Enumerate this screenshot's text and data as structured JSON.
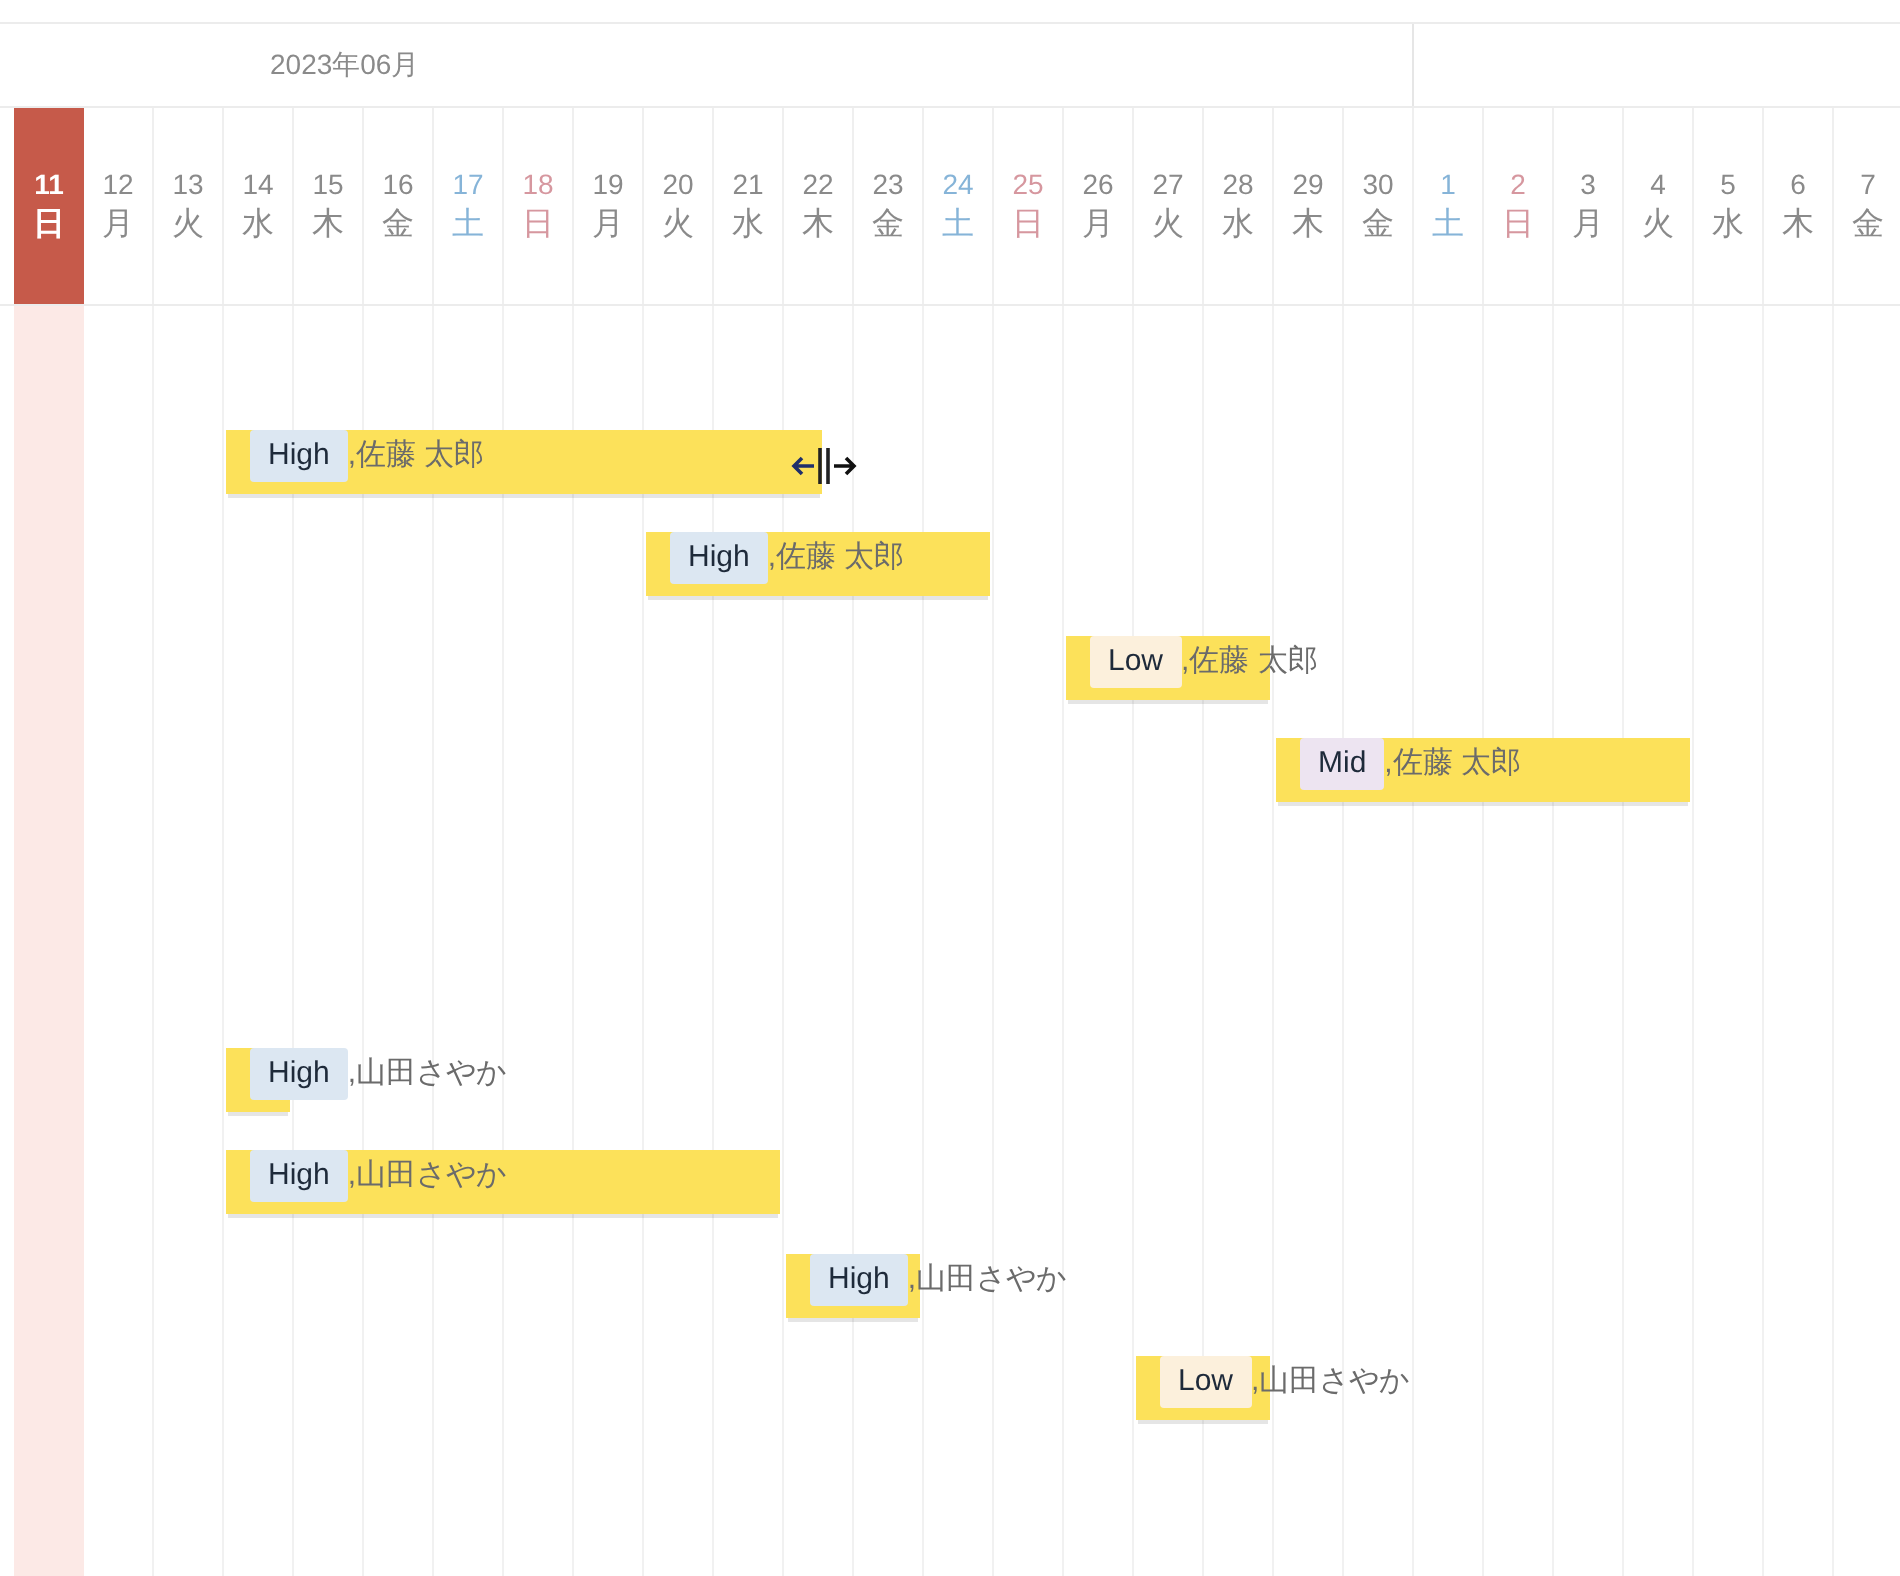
{
  "gantt": {
    "months": [
      {
        "label": "2023年06月",
        "days": [
          {
            "number": "11",
            "weekday": "日",
            "today": true
          },
          {
            "number": "12",
            "weekday": "月",
            "kind": "weekday",
            "today": false
          },
          {
            "number": "13",
            "weekday": "火",
            "kind": "weekday",
            "today": false
          },
          {
            "number": "14",
            "weekday": "水",
            "kind": "weekday",
            "today": false
          },
          {
            "number": "15",
            "weekday": "木",
            "kind": "weekday",
            "today": false
          },
          {
            "number": "16",
            "weekday": "金",
            "kind": "weekday",
            "today": false
          },
          {
            "number": "17",
            "weekday": "土",
            "kind": "saturday",
            "today": false
          },
          {
            "number": "18",
            "weekday": "日",
            "kind": "sunday",
            "today": false
          },
          {
            "number": "19",
            "weekday": "月",
            "kind": "weekday",
            "today": false
          },
          {
            "number": "20",
            "weekday": "火",
            "kind": "weekday",
            "today": false
          },
          {
            "number": "21",
            "weekday": "水",
            "kind": "weekday",
            "today": false
          },
          {
            "number": "22",
            "weekday": "木",
            "kind": "weekday",
            "today": false
          },
          {
            "number": "23",
            "weekday": "金",
            "kind": "weekday",
            "today": false
          },
          {
            "number": "24",
            "weekday": "土",
            "kind": "saturday",
            "today": false
          },
          {
            "number": "25",
            "weekday": "日",
            "kind": "sunday",
            "today": false
          },
          {
            "number": "26",
            "weekday": "月",
            "kind": "weekday",
            "today": false
          },
          {
            "number": "27",
            "weekday": "火",
            "kind": "weekday",
            "today": false
          },
          {
            "number": "28",
            "weekday": "水",
            "kind": "weekday",
            "today": false
          },
          {
            "number": "29",
            "weekday": "木",
            "kind": "weekday",
            "today": false
          },
          {
            "number": "30",
            "weekday": "金",
            "kind": "weekday",
            "today": false
          }
        ]
      },
      {
        "days": [
          {
            "number": "1",
            "weekday": "土",
            "kind": "saturday",
            "today": false
          },
          {
            "number": "2",
            "weekday": "日",
            "kind": "sunday",
            "today": false
          },
          {
            "number": "3",
            "weekday": "月",
            "kind": "weekday",
            "today": false
          },
          {
            "number": "4",
            "weekday": "火",
            "kind": "weekday",
            "today": false
          },
          {
            "number": "5",
            "weekday": "水",
            "kind": "weekday",
            "today": false
          },
          {
            "number": "6",
            "weekday": "木",
            "kind": "weekday",
            "today": false
          },
          {
            "number": "7",
            "weekday": "金",
            "kind": "weekday",
            "today": false
          }
        ]
      }
    ],
    "rows": [
      {
        "kind": "blank"
      },
      {
        "kind": "task",
        "priority": "High",
        "color": "#dce7f2",
        "label": ",佐藤 太郎",
        "resize_cursor": true
      },
      {
        "kind": "task",
        "priority": "High",
        "color": "#dce7f2",
        "label": ",佐藤 太郎",
        "resize_cursor": false
      },
      {
        "kind": "task",
        "priority": "Low",
        "color": "#fcf0dc",
        "label": ",佐藤 太郎",
        "resize_cursor": false
      },
      {
        "kind": "task",
        "priority": "Mid",
        "color": "#ede4f1",
        "label": ",佐藤 太郎",
        "resize_cursor": false
      },
      {
        "kind": "blank"
      },
      {
        "kind": "blank"
      },
      {
        "kind": "task",
        "priority": "High",
        "color": "#dce7f2",
        "label": ",山田さやか",
        "resize_cursor": false
      },
      {
        "kind": "task",
        "priority": "High",
        "color": "#dce7f2",
        "label": ",山田さやか",
        "resize_cursor": false
      },
      {
        "kind": "task",
        "priority": "High",
        "color": "#dce7f2",
        "label": ",山田さやか",
        "resize_cursor": false
      },
      {
        "kind": "task",
        "priority": "Low",
        "color": "#fcf0dc",
        "label": ",山田さやか",
        "resize_cursor": false
      }
    ]
  }
}
